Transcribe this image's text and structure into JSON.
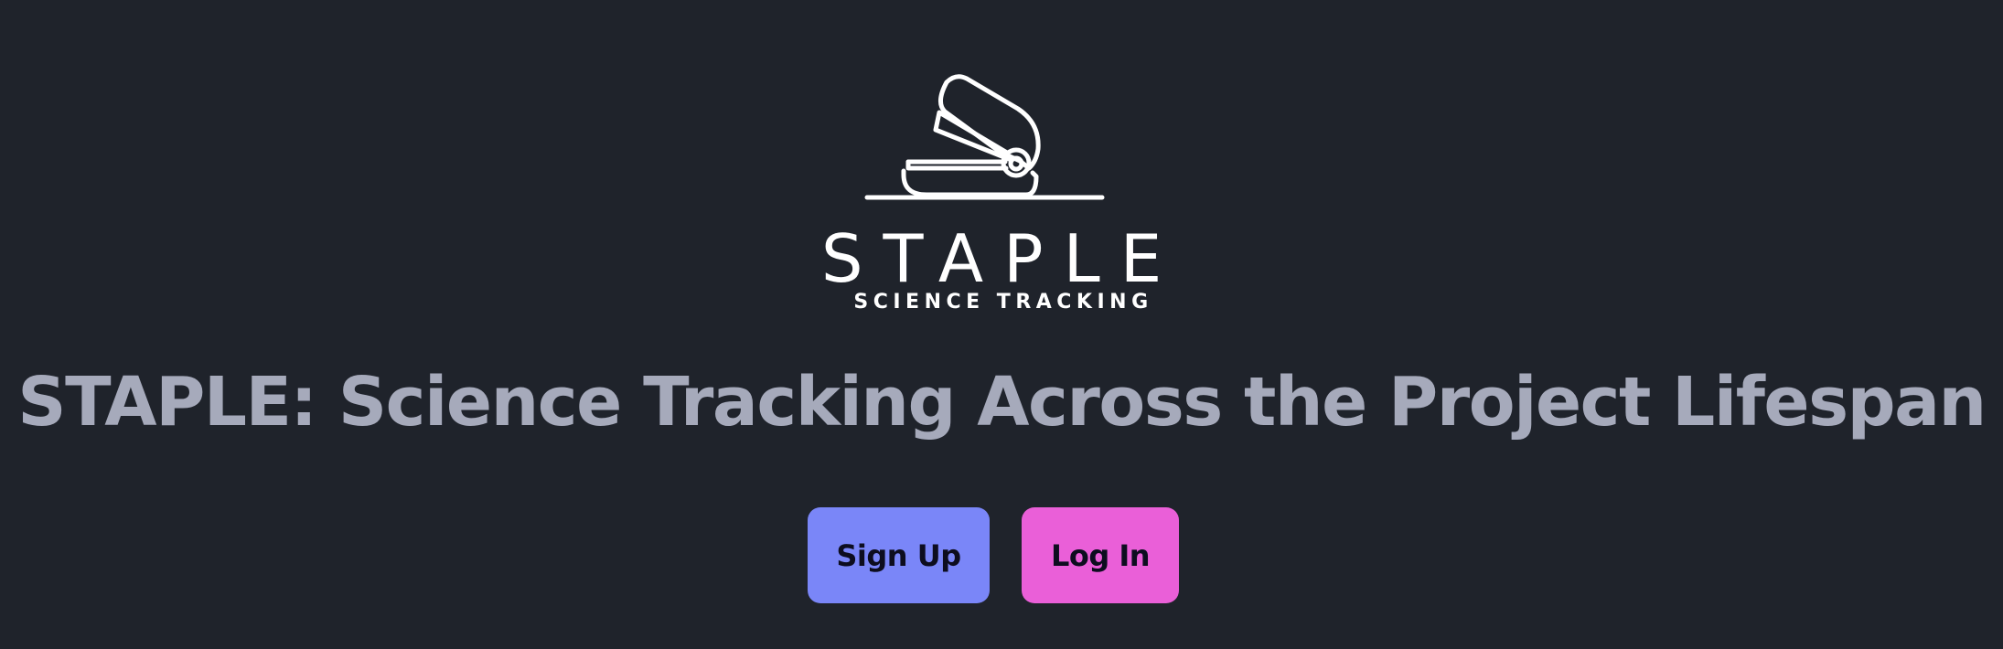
{
  "logo": {
    "wordmark": "STAPLE",
    "tagline": "SCIENCE TRACKING"
  },
  "hero": {
    "title": "STAPLE: Science Tracking Across the Project Lifespan"
  },
  "actions": {
    "signup_label": "Sign Up",
    "login_label": "Log In"
  },
  "colors": {
    "background": "#1f232b",
    "title_text": "#a6aabb",
    "signup_bg": "#7a86f8",
    "login_bg": "#ea5fd8",
    "button_text": "#0d0d1f"
  }
}
